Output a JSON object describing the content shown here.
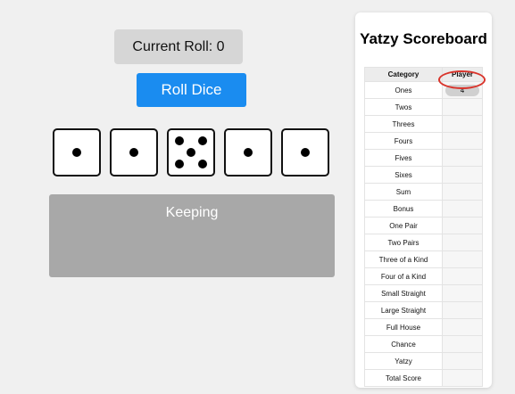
{
  "game": {
    "current_roll_label": "Current Roll: 0",
    "roll_button_label": "Roll Dice",
    "keeping_label": "Keeping"
  },
  "dice": [
    {
      "value": 1,
      "kept": false
    },
    {
      "value": 1,
      "kept": false
    },
    {
      "value": 5,
      "kept": false
    },
    {
      "value": 1,
      "kept": false
    },
    {
      "value": 1,
      "kept": false
    }
  ],
  "scoreboard": {
    "title": "Yatzy Scoreboard",
    "headers": {
      "category": "Category",
      "player": "Player"
    },
    "rows": [
      {
        "category": "Ones",
        "score": "4"
      },
      {
        "category": "Twos",
        "score": ""
      },
      {
        "category": "Threes",
        "score": ""
      },
      {
        "category": "Fours",
        "score": ""
      },
      {
        "category": "Fives",
        "score": ""
      },
      {
        "category": "Sixes",
        "score": ""
      },
      {
        "category": "Sum",
        "score": ""
      },
      {
        "category": "Bonus",
        "score": ""
      },
      {
        "category": "One Pair",
        "score": ""
      },
      {
        "category": "Two Pairs",
        "score": ""
      },
      {
        "category": "Three of a Kind",
        "score": ""
      },
      {
        "category": "Four of a Kind",
        "score": ""
      },
      {
        "category": "Small Straight",
        "score": ""
      },
      {
        "category": "Large Straight",
        "score": ""
      },
      {
        "category": "Full House",
        "score": ""
      },
      {
        "category": "Chance",
        "score": ""
      },
      {
        "category": "Yatzy",
        "score": ""
      },
      {
        "category": "Total Score",
        "score": ""
      }
    ]
  },
  "colors": {
    "accent": "#1a8cf0",
    "highlight": "#d9342b"
  }
}
